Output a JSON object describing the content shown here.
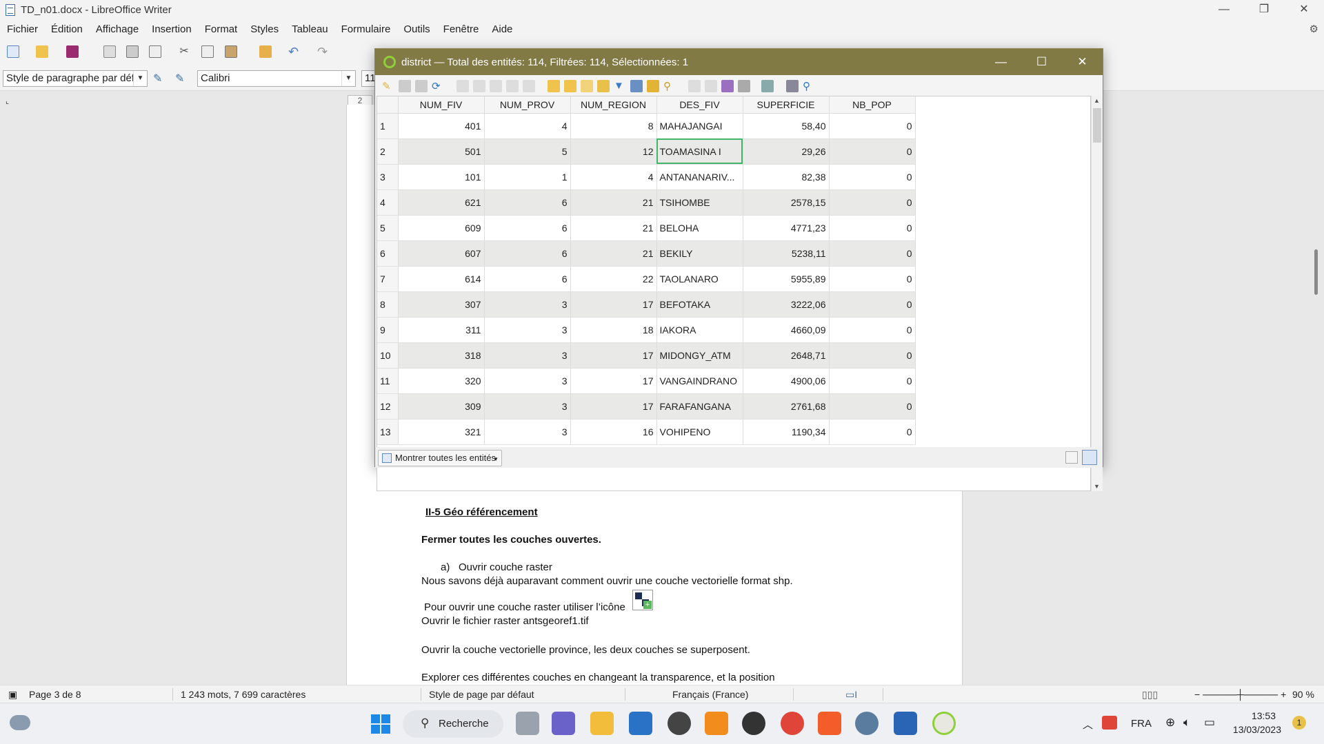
{
  "writer": {
    "title": "TD_n01.docx - LibreOffice Writer",
    "menu": [
      "Fichier",
      "Édition",
      "Affichage",
      "Insertion",
      "Format",
      "Styles",
      "Tableau",
      "Formulaire",
      "Outils",
      "Fenêtre",
      "Aide"
    ],
    "paragraph_style": "Style de paragraphe par déf",
    "font_name": "Calibri",
    "font_size": "11",
    "ruler_label": "2",
    "document": {
      "heading": "II-5 Géo référencement",
      "line1": "Fermer toutes les couches ouvertes.",
      "list_marker": "a)",
      "list_item": "Ouvrir couche raster",
      "line2": "Nous savons déjà auparavant comment ouvrir une couche vectorielle format shp.",
      "line3": "Pour ouvrir une couche raster utiliser l’icône",
      "line4": "Ouvrir le fichier raster antsgeoref1.tif",
      "line5": "Ouvrir la couche vectorielle province, les deux couches se superposent.",
      "line6": "Explorer ces différentes couches en changeant la transparence, et la position"
    },
    "status": {
      "page": "Page 3 de 8",
      "words": "1 243 mots, 7 699 caractères",
      "page_style": "Style de page par défaut",
      "language": "Français (France)",
      "zoom": "90 %"
    }
  },
  "qgis": {
    "title": "district — Total des entités: 114, Filtrées: 114, Sélectionnées: 1",
    "columns": [
      "NUM_FIV",
      "NUM_PROV",
      "NUM_REGION",
      "DES_FIV",
      "SUPERFICIE",
      "NB_POP"
    ],
    "rows": [
      [
        "1",
        "401",
        "4",
        "8",
        "MAHAJANGAI",
        "58,40",
        "0"
      ],
      [
        "2",
        "501",
        "5",
        "12",
        "TOAMASINA I",
        "29,26",
        "0"
      ],
      [
        "3",
        "101",
        "1",
        "4",
        "ANTANANARIV...",
        "82,38",
        "0"
      ],
      [
        "4",
        "621",
        "6",
        "21",
        "TSIHOMBE",
        "2578,15",
        "0"
      ],
      [
        "5",
        "609",
        "6",
        "21",
        "BELOHA",
        "4771,23",
        "0"
      ],
      [
        "6",
        "607",
        "6",
        "21",
        "BEKILY",
        "5238,11",
        "0"
      ],
      [
        "7",
        "614",
        "6",
        "22",
        "TAOLANARO",
        "5955,89",
        "0"
      ],
      [
        "8",
        "307",
        "3",
        "17",
        "BEFOTAKA",
        "3222,06",
        "0"
      ],
      [
        "9",
        "311",
        "3",
        "18",
        "IAKORA",
        "4660,09",
        "0"
      ],
      [
        "10",
        "318",
        "3",
        "17",
        "MIDONGY_ATM",
        "2648,71",
        "0"
      ],
      [
        "11",
        "320",
        "3",
        "17",
        "VANGAINDRANO",
        "4900,06",
        "0"
      ],
      [
        "12",
        "309",
        "3",
        "17",
        "FARAFANGANA",
        "2761,68",
        "0"
      ],
      [
        "13",
        "321",
        "3",
        "16",
        "VOHIPENO",
        "1190,34",
        "0"
      ]
    ],
    "show_all_label": "Montrer toutes les entités"
  },
  "taskbar": {
    "search": "Recherche",
    "language": "FRA",
    "time": "13:53",
    "date": "13/03/2023",
    "notif_count": "1"
  },
  "colors": {
    "qgis_title": "#827a45",
    "selection": "#43b56a",
    "alt_row": "#e9e9e7"
  }
}
